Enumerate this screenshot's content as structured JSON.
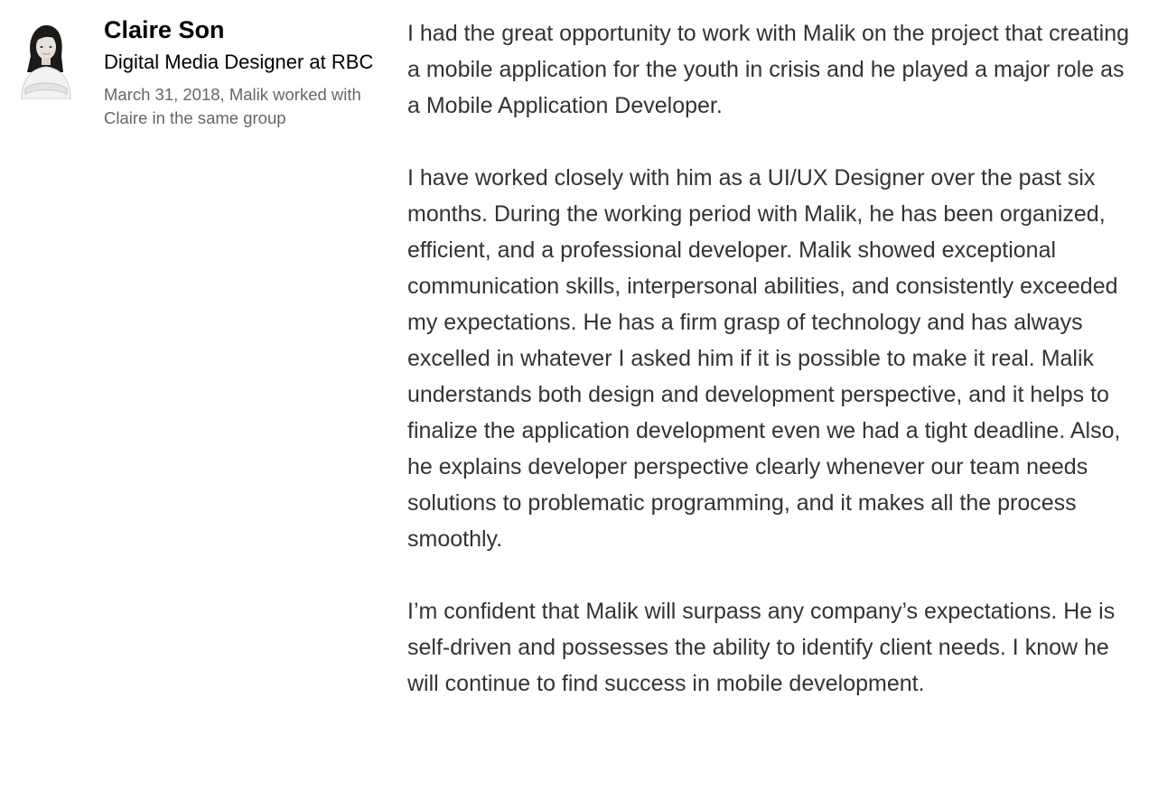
{
  "recommender": {
    "name": "Claire Son",
    "headline": "Digital Media Designer at RBC",
    "meta": "March 31, 2018, Malik worked with Claire in the same group",
    "avatar_icon": "profile-photo"
  },
  "recommendation": {
    "paragraphs": [
      "I had the great opportunity to work with Malik on the project that creating a mobile application for the youth in crisis and he played a major role as a Mobile Application Developer.",
      "I have worked closely with him as a UI/UX Designer over the past six months. During the working period with Malik, he has been organized, efficient, and a professional developer. Malik showed exceptional communication skills, interpersonal abilities, and consistently exceeded my expectations. He has a firm grasp of technology and has always excelled in whatever I asked him if it is possible to make it real. Malik understands both design and development perspective, and it helps to finalize the application development even we had a tight deadline. Also, he explains developer perspective clearly whenever our team needs solutions to problematic programming, and it makes all the process smoothly.",
      "I’m confident that Malik will surpass any company’s expectations. He is self-driven and possesses the ability to identify client needs. I know he will continue to find success in mobile development."
    ]
  }
}
